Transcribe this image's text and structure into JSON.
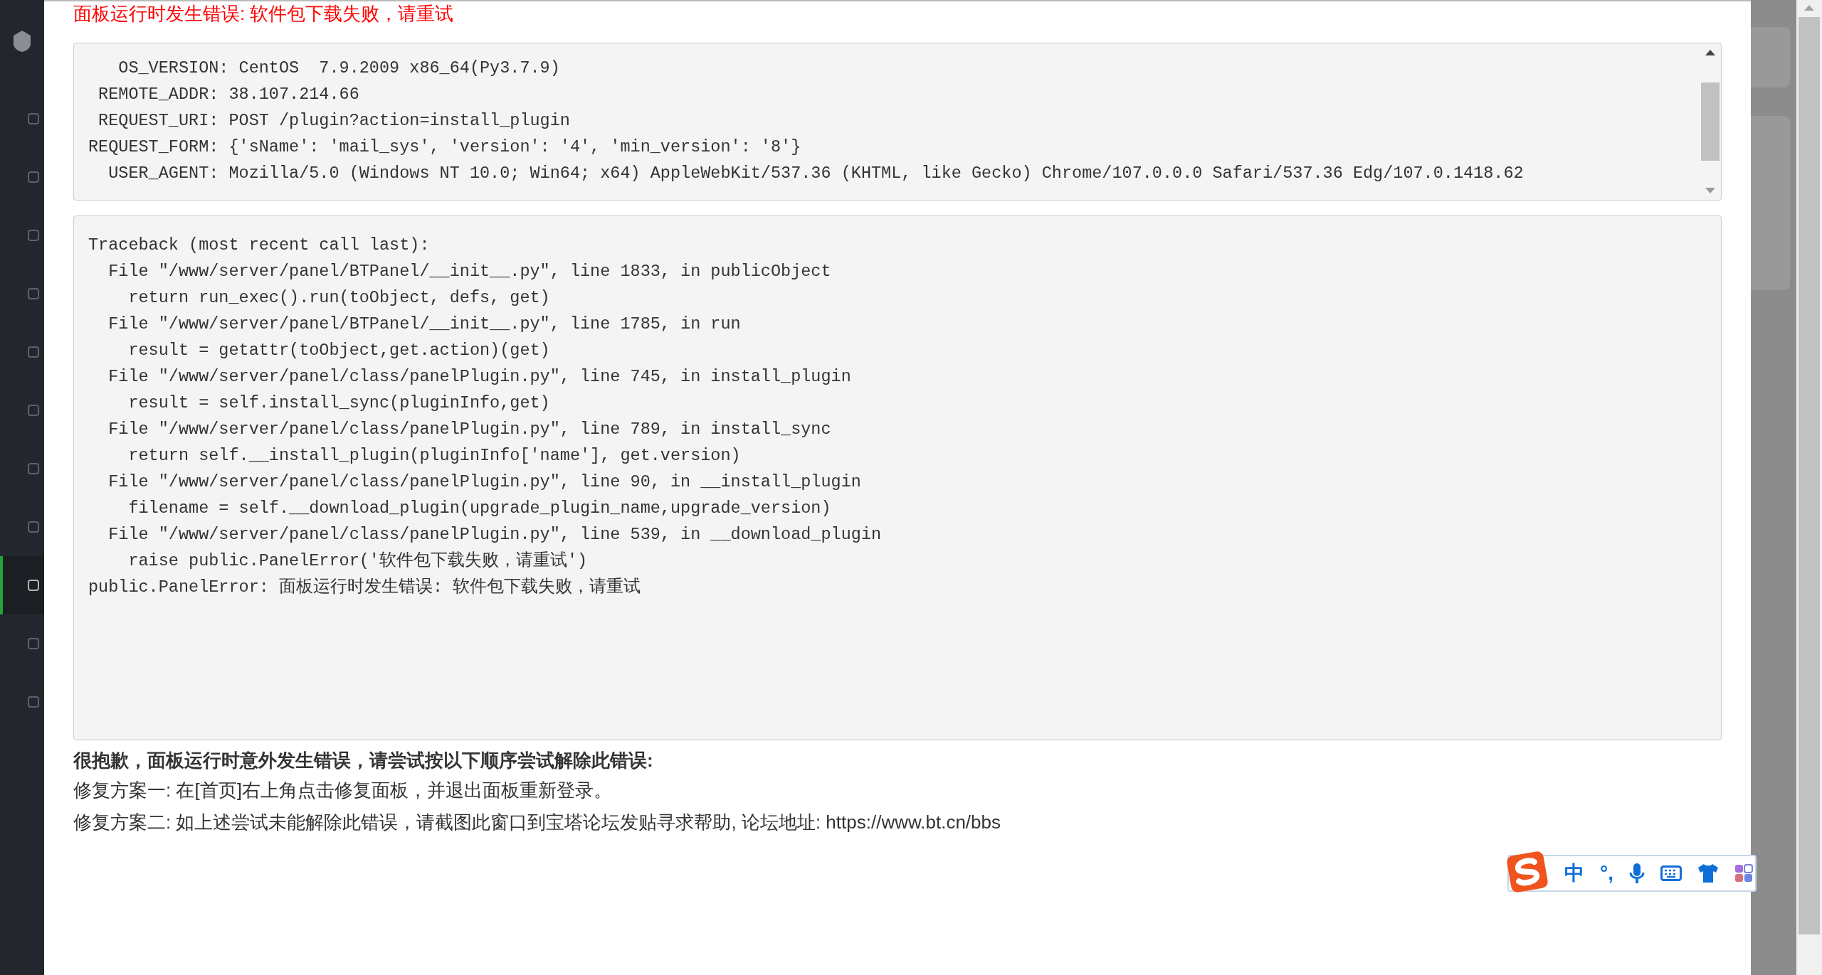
{
  "error_title": "面板运行时发生错误: 软件包下载失败，请重试",
  "request_info": [
    "   OS_VERSION: CentOS  7.9.2009 x86_64(Py3.7.9)",
    " REMOTE_ADDR: 38.107.214.66",
    " REQUEST_URI: POST /plugin?action=install_plugin",
    "REQUEST_FORM: {'sName': 'mail_sys', 'version': '4', 'min_version': '8'}",
    "  USER_AGENT: Mozilla/5.0 (Windows NT 10.0; Win64; x64) AppleWebKit/537.36 (KHTML, like Gecko) Chrome/107.0.0.0 Safari/537.36 Edg/107.0.1418.62"
  ],
  "traceback": [
    "Traceback (most recent call last):",
    "  File \"/www/server/panel/BTPanel/__init__.py\", line 1833, in publicObject",
    "    return run_exec().run(toObject, defs, get)",
    "  File \"/www/server/panel/BTPanel/__init__.py\", line 1785, in run",
    "    result = getattr(toObject,get.action)(get)",
    "  File \"/www/server/panel/class/panelPlugin.py\", line 745, in install_plugin",
    "    result = self.install_sync(pluginInfo,get)",
    "  File \"/www/server/panel/class/panelPlugin.py\", line 789, in install_sync",
    "    return self.__install_plugin(pluginInfo['name'], get.version)",
    "  File \"/www/server/panel/class/panelPlugin.py\", line 90, in __install_plugin",
    "    filename = self.__download_plugin(upgrade_plugin_name,upgrade_version)",
    "  File \"/www/server/panel/class/panelPlugin.py\", line 539, in __download_plugin",
    "    raise public.PanelError('软件包下载失败，请重试')",
    "public.PanelError: 面板运行时发生错误: 软件包下载失败，请重试"
  ],
  "help": {
    "heading": "很抱歉，面板运行时意外发生错误，请尝试按以下顺序尝试解除此错误:",
    "steps": [
      "修复方案一: 在[首页]右上角点击修复面板，并退出面板重新登录。",
      "修复方案二: 如上述尝试未能解除此错误，请截图此窗口到宝塔论坛发贴寻求帮助, 论坛地址: https://www.bt.cn/bbs"
    ]
  },
  "sidebar": {
    "items": [
      {
        "selected": false
      },
      {
        "selected": false
      },
      {
        "selected": false
      },
      {
        "selected": false
      },
      {
        "selected": false
      },
      {
        "selected": false
      },
      {
        "selected": false
      },
      {
        "selected": false
      },
      {
        "selected": true
      },
      {
        "selected": false
      },
      {
        "selected": false
      }
    ]
  },
  "ime_toolbar": {
    "mode": "中",
    "punctuation": "°,"
  }
}
